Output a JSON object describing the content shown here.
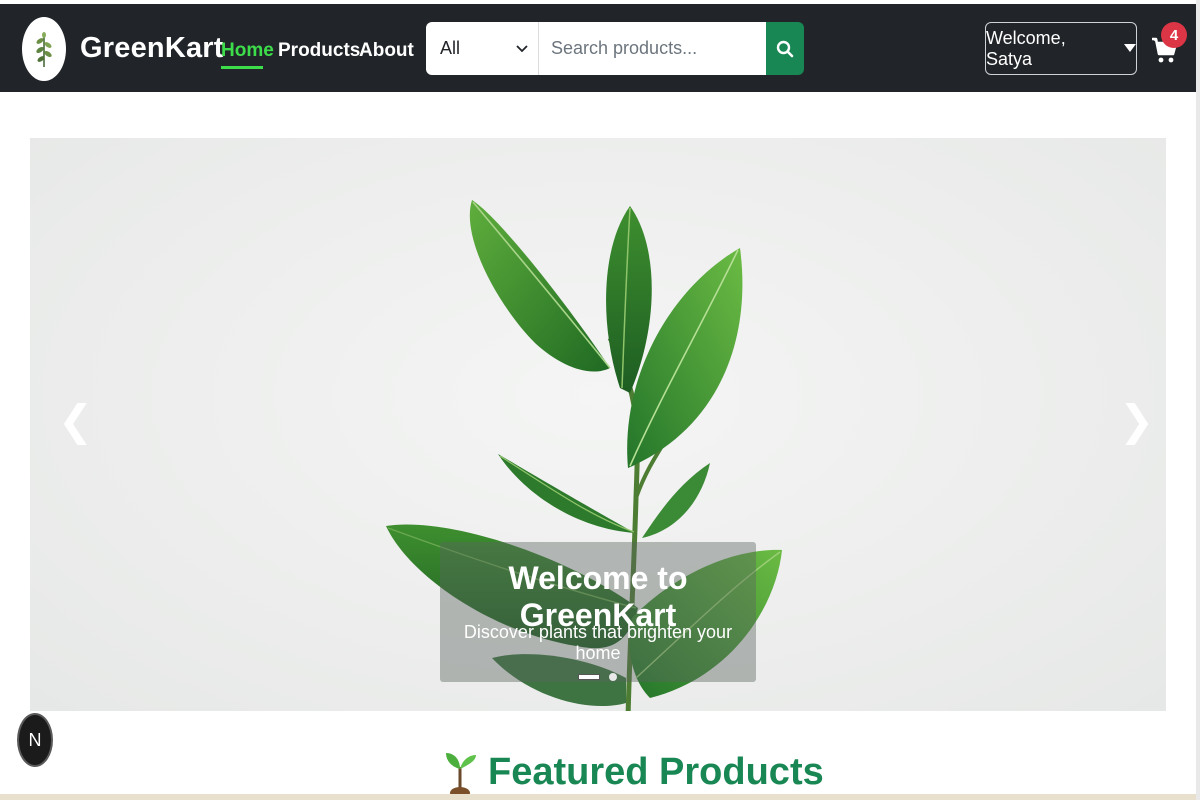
{
  "brand": {
    "name": "GreenKart",
    "logo_icon": "sprout-leaf-icon"
  },
  "nav": {
    "links": [
      {
        "label": "Home",
        "active": true
      },
      {
        "label": "Products"
      },
      {
        "label": "About"
      }
    ]
  },
  "search": {
    "category": "All",
    "placeholder": "Search products...",
    "button_icon": "search-icon"
  },
  "user": {
    "welcome": "Welcome, Satya"
  },
  "cart": {
    "count": "4",
    "icon": "cart-icon"
  },
  "hero": {
    "title": "Welcome to GreenKart",
    "subtitle": "Discover plants that brighten your home",
    "prev_symbol": "❮",
    "next_symbol": "❯",
    "slides": 2,
    "active_slide": 1
  },
  "floating": {
    "label": "N"
  },
  "featured": {
    "title": "Featured Products",
    "icon": "seedling-icon"
  },
  "colors": {
    "navbar": "#212529",
    "accent_green": "#3ddc4a",
    "brand_green": "#198754",
    "badge_red": "#dc3545"
  }
}
